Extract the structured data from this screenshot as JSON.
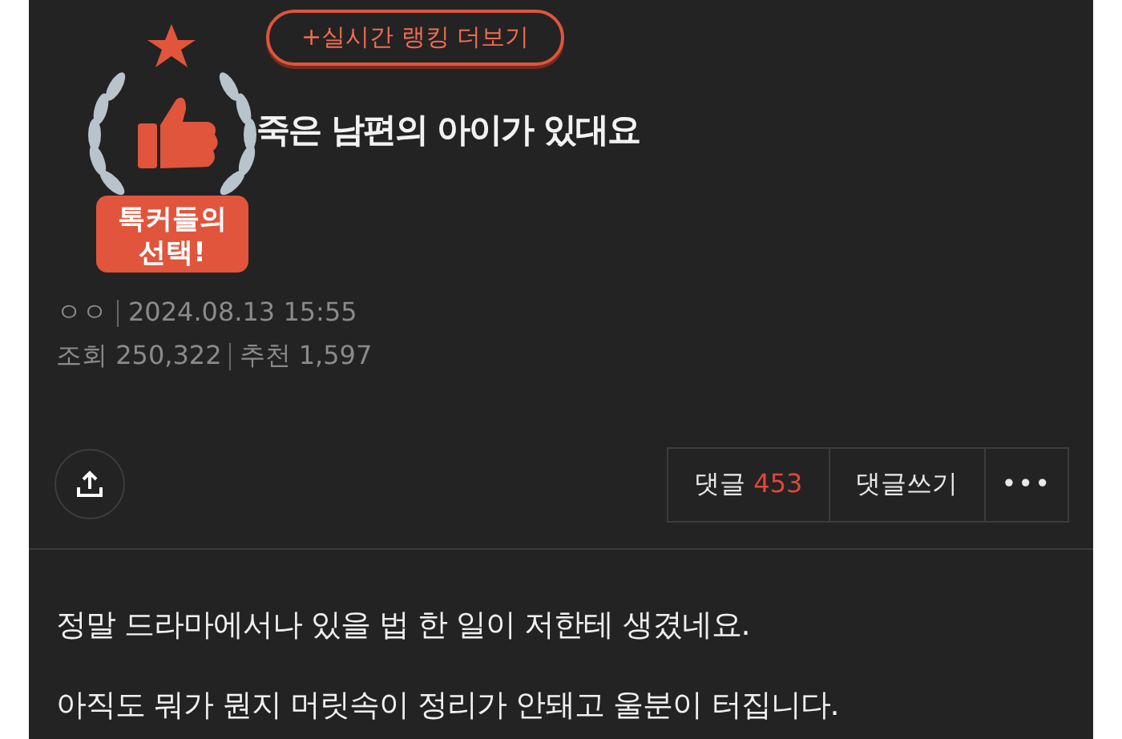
{
  "ranking_link": "+실시간 랭킹 더보기",
  "badge": {
    "line_1": "톡커들의",
    "line_2": "선택!"
  },
  "post": {
    "title": "죽은 남편의 아이가 있대요",
    "author": "ㅇㅇ",
    "date": "2024.08.13 15:55",
    "views_label": "조회",
    "views": "250,322",
    "likes_label": "추천",
    "likes": "1,597"
  },
  "actions": {
    "comments_label": "댓글",
    "comments_count": "453",
    "write_comment": "댓글쓰기",
    "more": "•••"
  },
  "body": [
    "정말 드라마에서나 있을 법 한 일이 저한테 생겼네요.",
    "아직도 뭐가 뭔지 머릿속이 정리가 안돼고 울분이 터집니다."
  ]
}
